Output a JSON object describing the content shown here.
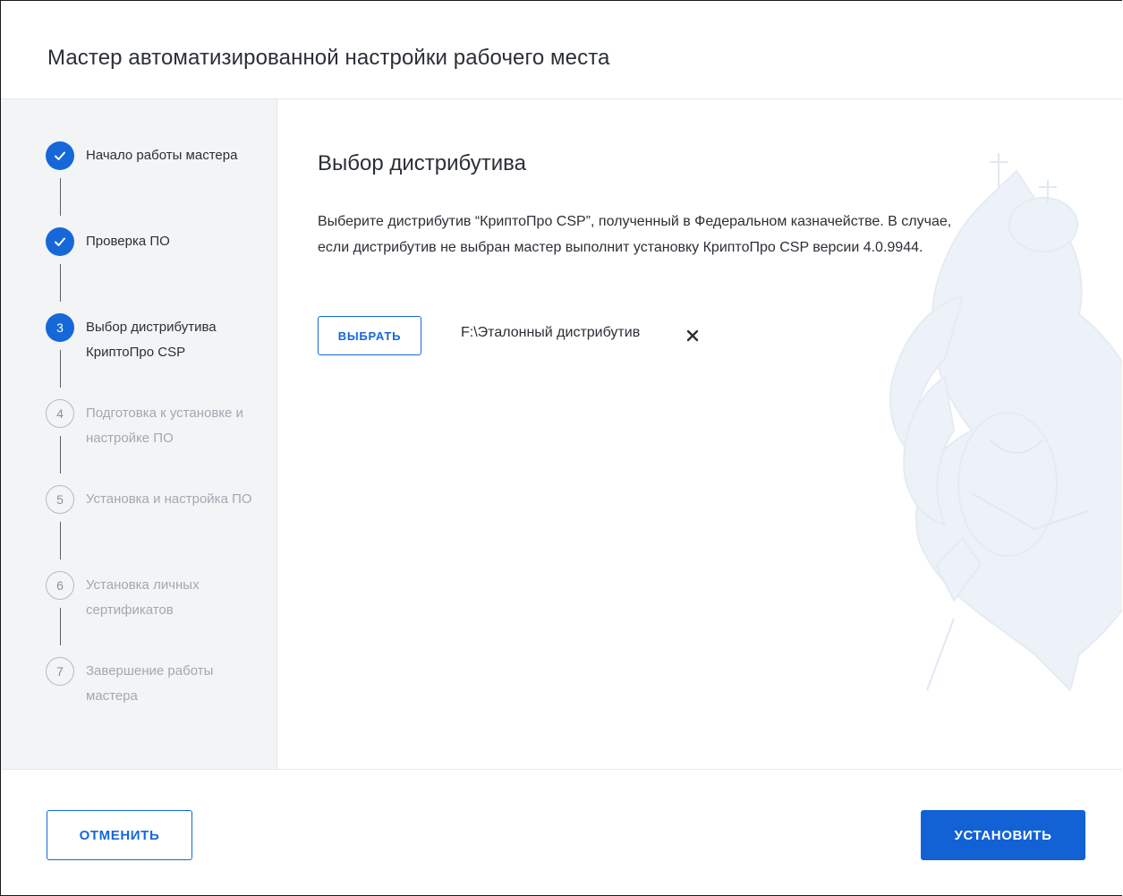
{
  "window": {
    "title": "Мастер автоматизированной настройки рабочего места"
  },
  "steps": [
    {
      "number": "1",
      "label": "Начало работы мастера",
      "state": "done"
    },
    {
      "number": "2",
      "label": "Проверка ПО",
      "state": "done"
    },
    {
      "number": "3",
      "label": "Выбор дистрибутива КриптоПро CSP",
      "state": "active"
    },
    {
      "number": "4",
      "label": "Подготовка к установке и настройке ПО",
      "state": "pending"
    },
    {
      "number": "5",
      "label": "Установка и настройка ПО",
      "state": "pending"
    },
    {
      "number": "6",
      "label": "Установка личных сертификатов",
      "state": "pending"
    },
    {
      "number": "7",
      "label": "Завершение работы мастера",
      "state": "pending"
    }
  ],
  "main": {
    "heading": "Выбор дистрибутива",
    "description": "Выберите дистрибутив “КриптоПро CSP”, полученный в Федеральном казначействе. В случае, если дистрибутив не выбран мастер выполнит установку КриптоПро CSP версии 4.0.9944.",
    "select_button": "ВЫБРАТЬ",
    "selected_file": "F:\\Эталонный дистрибутив"
  },
  "footer": {
    "cancel_button": "ОТМЕНИТЬ",
    "install_button": "УСТАНОВИТЬ"
  },
  "colors": {
    "accent": "#1668d9",
    "sidebar_bg": "#f3f4f6",
    "pending": "#a3a8b0"
  },
  "icons": {
    "done_step": "check-icon",
    "clear_file": "close-icon",
    "background": "double-headed-eagle-emblem"
  }
}
